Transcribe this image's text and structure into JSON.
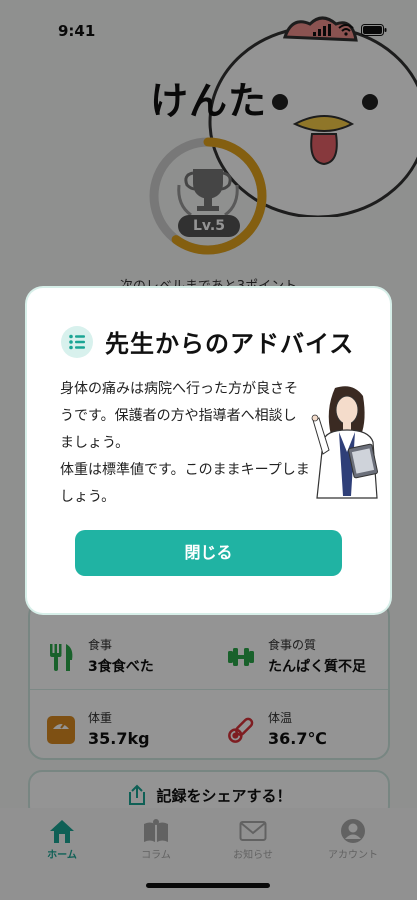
{
  "status_bar": {
    "time": "9:41"
  },
  "user": {
    "name": "けんた",
    "level": "Lv.5",
    "next_level_text": "次のレベルまであと3ポイント",
    "level_progress": 0.6
  },
  "stats": {
    "meal": {
      "label": "食事",
      "value": "3食食べた"
    },
    "meal_quality": {
      "label": "食事の質",
      "value": "たんぱく質不足"
    },
    "weight": {
      "label": "体重",
      "value": "35.7kg"
    },
    "temperature": {
      "label": "体温",
      "value": "36.7℃"
    }
  },
  "share": {
    "label": "記録をシェアする！"
  },
  "tabs": [
    {
      "label": "ホーム",
      "icon": "home-icon",
      "active": true
    },
    {
      "label": "コラム",
      "icon": "book-icon",
      "active": false
    },
    {
      "label": "お知らせ",
      "icon": "mail-icon",
      "active": false
    },
    {
      "label": "アカウント",
      "icon": "account-icon",
      "active": false
    }
  ],
  "modal": {
    "title": "先生からのアドバイス",
    "advice_lines": [
      "身体の痛みは病院へ行った方が良さそうです。保護者の方や指導者へ相談しましょう。",
      "体重は標準値です。このままキープしましょう。"
    ],
    "close_label": "閉じる"
  },
  "colors": {
    "accent": "#20b3a3",
    "level_ring": "#e3a41c",
    "temperature_icon": "#d9323a",
    "weight_icon": "#d98b22",
    "meal_icon": "#2ba84a"
  }
}
